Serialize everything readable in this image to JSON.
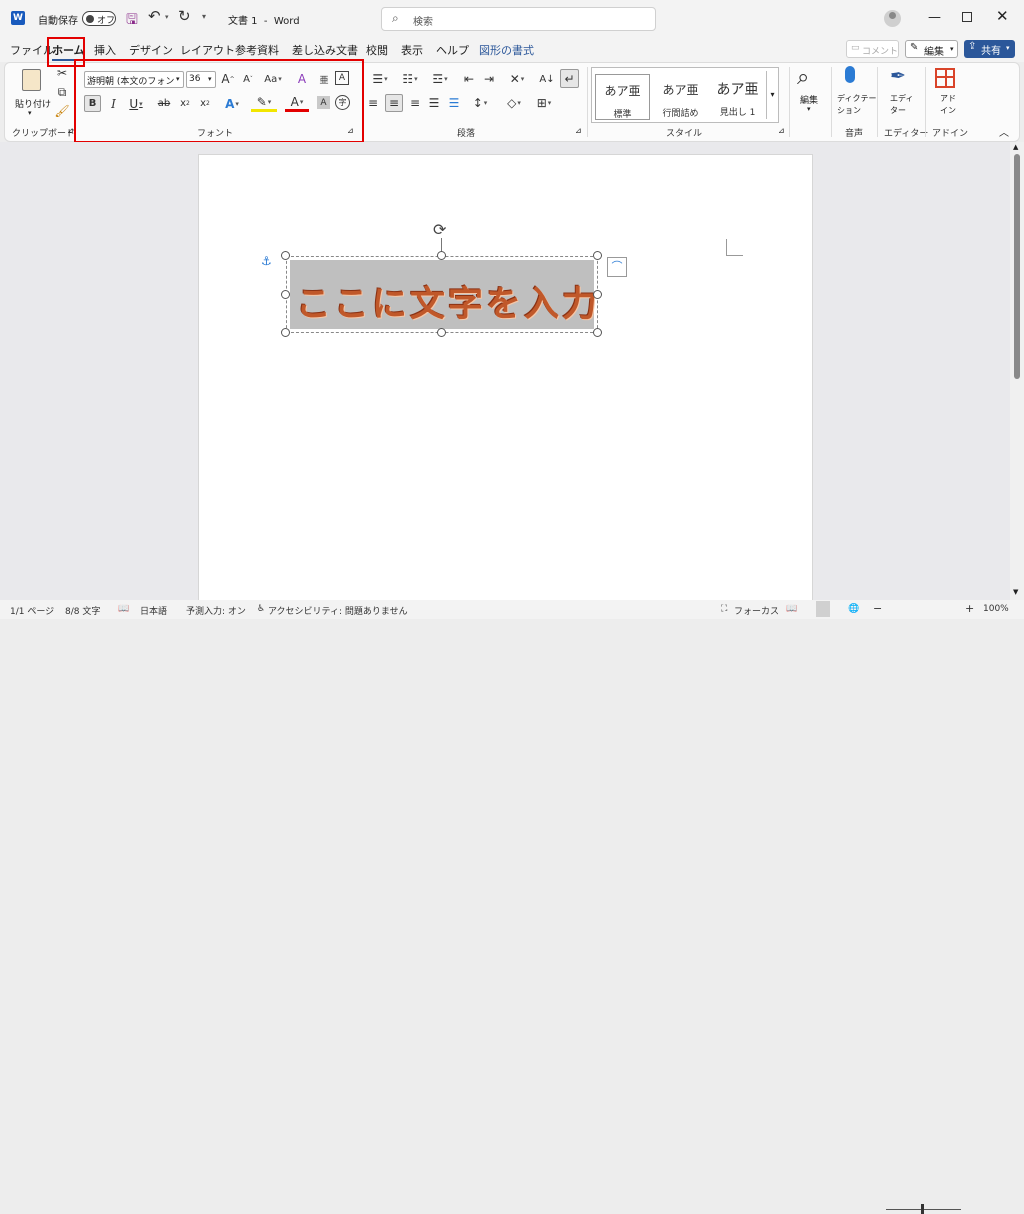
{
  "titlebar": {
    "autosave_label": "自動保存",
    "autosave_state": "オフ",
    "doc_title": "文書 1  -  Word",
    "search_placeholder": "検索"
  },
  "tabs": [
    "ファイル",
    "ホーム",
    "挿入",
    "デザイン",
    "レイアウト",
    "参考資料",
    "差し込み文書",
    "校閲",
    "表示",
    "ヘルプ",
    "図形の書式"
  ],
  "active_tab": "ホーム",
  "comment_label": "コメント",
  "edit_label": "編集",
  "share_label": "共有",
  "ribbon": {
    "clipboard": {
      "paste_label": "貼り付け",
      "group_label": "クリップボード"
    },
    "font": {
      "font_name": "游明朝 (本文のフォント",
      "font_size": "36",
      "group_label": "フォント"
    },
    "paragraph": {
      "group_label": "段落"
    },
    "styles": {
      "items": [
        {
          "preview": "あア亜",
          "name": "標準"
        },
        {
          "preview": "あア亜",
          "name": "行間詰め"
        },
        {
          "preview": "あア亜",
          "name": "見出し 1"
        }
      ],
      "group_label": "スタイル"
    },
    "editing": {
      "label": "編集"
    },
    "voice": {
      "label": "ディクテー\nション",
      "group_label": "音声"
    },
    "editor": {
      "label": "エディ\nター",
      "group_label": "エディター"
    },
    "addins": {
      "label": "アド\nイン",
      "group_label": "アドイン"
    }
  },
  "document": {
    "textbox_text": "ここに文字を入力"
  },
  "status": {
    "page": "1/1 ページ",
    "words": "8/8 文字",
    "language": "日本語",
    "predict": "予測入力: オン",
    "accessibility": "アクセシビリティ: 問題ありません",
    "focus": "フォーカス",
    "zoom": "100%"
  },
  "colors": {
    "accent": "#2b579a",
    "highlight_red": "#e30000",
    "wordart": "#c0582a"
  }
}
